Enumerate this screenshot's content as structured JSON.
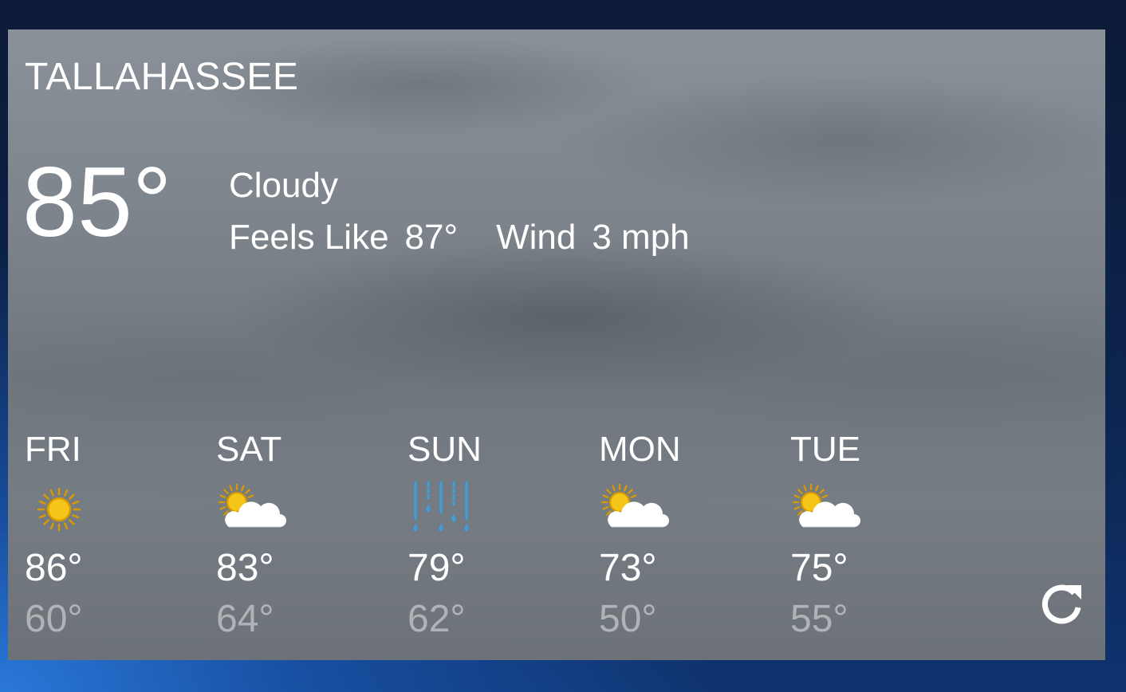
{
  "location": {
    "city": "TALLAHASSEE"
  },
  "current": {
    "temperature": "85°",
    "condition": "Cloudy",
    "feels_like_label": "Feels Like",
    "feels_like_value": "87°",
    "wind_label": "Wind",
    "wind_value": "3 mph"
  },
  "forecast": [
    {
      "day": "FRI",
      "icon": "sunny-icon",
      "high": "86°",
      "low": "60°"
    },
    {
      "day": "SAT",
      "icon": "partly-cloudy-icon",
      "high": "83°",
      "low": "64°"
    },
    {
      "day": "SUN",
      "icon": "rain-icon",
      "high": "79°",
      "low": "62°"
    },
    {
      "day": "MON",
      "icon": "partly-cloudy-icon",
      "high": "73°",
      "low": "50°"
    },
    {
      "day": "TUE",
      "icon": "partly-cloudy-icon",
      "high": "75°",
      "low": "55°"
    }
  ],
  "controls": {
    "refresh_icon": "refresh-icon"
  },
  "colors": {
    "sun": "#f5c518",
    "sun_outline": "#d79a00",
    "cloud": "#ffffff",
    "rain": "#3aa0e0",
    "low_temp_text": "rgba(255,255,255,0.45)"
  }
}
